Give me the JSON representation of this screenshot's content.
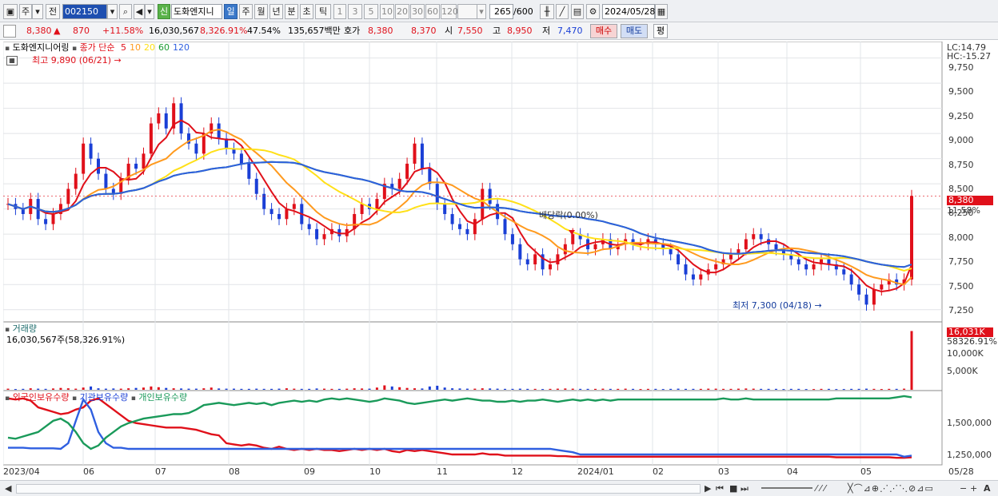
{
  "toolbar": {
    "type_label": "주",
    "prev_label": "전",
    "code_value": "002150",
    "stock_name": "도화엔지니",
    "badge_label": "신",
    "periods": [
      "일",
      "주",
      "월",
      "년",
      "분",
      "초",
      "틱"
    ],
    "minutes": [
      "1",
      "3",
      "5",
      "10",
      "20",
      "30",
      "60",
      "120"
    ],
    "count_value": "265",
    "count_max": "/600",
    "date_value": "2024/05/28"
  },
  "quote": {
    "price": "8,380",
    "change": "870",
    "change_pct": "+11.58%",
    "volume": "16,030,567",
    "volume_pct": "8,326.91%",
    "turnover_pct": "47.54%",
    "amount": "135,657백만",
    "hoga_label": "호가",
    "hoga_ask": "8,380",
    "hoga_bid": "8,370",
    "open_label": "시",
    "open": "7,550",
    "high_label": "고",
    "high": "8,950",
    "low_label": "저",
    "low": "7,470",
    "buy_label": "매수",
    "sell_label": "매도",
    "eval_label": "평"
  },
  "price_panel": {
    "name": "도화엔지니어링",
    "ma_title": "종가 단순",
    "ma_periods": [
      "5",
      "10",
      "20",
      "60",
      "120"
    ],
    "ma_colors": [
      "#e0101a",
      "#ff9a1e",
      "#ffe018",
      "#1a9a30",
      "#2f5fe0"
    ],
    "max_label": "최고 9,890 (06/21)",
    "min_label": "최저 7,300 (04/18)",
    "dividend_label": "배당락(0.00%)",
    "lc_label": "LC:14.79",
    "hc_label": "HC:-15.27",
    "last_price_label": "8,380",
    "last_pct_label": "11.58%",
    "y_ticks": [
      "9,750",
      "9,500",
      "9,250",
      "9,000",
      "8,750",
      "8,500",
      "8,250",
      "8,000",
      "7,750",
      "7,500",
      "7,250"
    ]
  },
  "volume_panel": {
    "title": "거래량",
    "value_label": "16,030,567주(58,326.91%)",
    "last_label": "16,031K",
    "last_pct": "58326.91%",
    "y_ticks": [
      "10,000K",
      "5,000K"
    ]
  },
  "holding_panel": {
    "legend": [
      "외국인보유수량",
      "기관보유수량",
      "개인보유수량"
    ],
    "colors": [
      "#e0101a",
      "#2f5fe0",
      "#1a9a5a"
    ],
    "y_ticks": [
      "1,500,000",
      "1,250,000"
    ]
  },
  "x_axis": [
    "2023/04",
    "06",
    "07",
    "08",
    "09",
    "10",
    "11",
    "12",
    "2024/01",
    "02",
    "03",
    "04",
    "05",
    "05/28"
  ],
  "chart_data": {
    "type": "line",
    "title": "도화엔지니어링",
    "ylim": [
      7200,
      9850
    ],
    "close": [
      8300,
      8250,
      8200,
      8350,
      8150,
      8100,
      8200,
      8300,
      8450,
      8600,
      8900,
      8750,
      8600,
      8450,
      8400,
      8550,
      8700,
      8650,
      8800,
      9100,
      9200,
      9050,
      9300,
      9000,
      8900,
      8800,
      9000,
      9100,
      8950,
      8850,
      8800,
      8700,
      8550,
      8400,
      8250,
      8200,
      8150,
      8250,
      8300,
      8100,
      8050,
      7950,
      8000,
      8050,
      7980,
      8050,
      8200,
      8300,
      8250,
      8350,
      8500,
      8450,
      8550,
      8700,
      8900,
      8650,
      8500,
      8300,
      8200,
      8100,
      8050,
      8000,
      8150,
      8450,
      8300,
      8150,
      8000,
      7900,
      7750,
      7700,
      7800,
      7650,
      7700,
      7800,
      7900,
      8000,
      7950,
      7850,
      7900,
      7950,
      7850,
      7900,
      7950,
      7900,
      7900,
      7950,
      7900,
      7850,
      7800,
      7700,
      7600,
      7550,
      7600,
      7650,
      7700,
      7750,
      7800,
      7850,
      7950,
      8000,
      7950,
      7900,
      7850,
      7800,
      7750,
      7700,
      7650,
      7700,
      7750,
      7700,
      7650,
      7600,
      7500,
      7400,
      7300,
      7450,
      7500,
      7550,
      7500,
      7550,
      8380
    ],
    "volume_k": [
      300,
      200,
      250,
      400,
      300,
      250,
      350,
      500,
      400,
      300,
      600,
      900,
      400,
      300,
      350,
      300,
      400,
      500,
      600,
      900,
      700,
      500,
      400,
      350,
      300,
      300,
      400,
      600,
      350,
      300,
      300,
      250,
      250,
      300,
      250,
      250,
      300,
      400,
      300,
      250,
      250,
      350,
      300,
      250,
      250,
      300,
      400,
      350,
      300,
      600,
      1200,
      900,
      700,
      500,
      400,
      350,
      900,
      1100,
      600,
      400,
      350,
      300,
      300,
      400,
      350,
      300,
      250,
      250,
      300,
      250,
      250,
      200,
      250,
      300,
      350,
      300,
      250,
      250,
      250,
      300,
      250,
      250,
      300,
      250,
      200,
      250,
      250,
      200,
      250,
      300,
      250,
      250,
      250,
      300,
      300,
      250,
      250,
      300,
      350,
      300,
      250,
      250,
      250,
      200,
      250,
      250,
      200,
      200,
      250,
      250,
      200,
      200,
      250,
      250,
      300,
      250,
      200,
      250,
      250,
      300,
      16031
    ],
    "foreign": [
      1700,
      1690,
      1700,
      1680,
      1620,
      1600,
      1580,
      1560,
      1570,
      1600,
      1620,
      1680,
      1700,
      1650,
      1600,
      1550,
      1500,
      1480,
      1470,
      1460,
      1450,
      1440,
      1440,
      1440,
      1430,
      1420,
      1400,
      1380,
      1370,
      1300,
      1290,
      1280,
      1290,
      1280,
      1260,
      1250,
      1270,
      1250,
      1240,
      1250,
      1240,
      1250,
      1240,
      1240,
      1230,
      1240,
      1250,
      1240,
      1250,
      1240,
      1250,
      1230,
      1220,
      1240,
      1230,
      1240,
      1230,
      1220,
      1210,
      1200,
      1200,
      1200,
      1200,
      1210,
      1200,
      1200,
      1190,
      1190,
      1190,
      1190,
      1190,
      1190,
      1190,
      1185,
      1185,
      1180,
      1180,
      1180,
      1180,
      1180,
      1180,
      1180,
      1180,
      1180,
      1180,
      1180,
      1180,
      1180,
      1180,
      1180,
      1180,
      1180,
      1180,
      1180,
      1180,
      1180,
      1180,
      1180,
      1180,
      1180,
      1180,
      1180,
      1180,
      1180,
      1180,
      1180,
      1180,
      1180,
      1180,
      1180,
      1175,
      1175,
      1175,
      1175,
      1175,
      1175,
      1175,
      1175,
      1170,
      1170,
      1175
    ],
    "institution": [
      1260,
      1260,
      1260,
      1255,
      1255,
      1255,
      1255,
      1250,
      1300,
      1500,
      1690,
      1600,
      1400,
      1300,
      1260,
      1260,
      1250,
      1250,
      1250,
      1250,
      1250,
      1250,
      1250,
      1250,
      1250,
      1250,
      1250,
      1250,
      1250,
      1250,
      1250,
      1250,
      1250,
      1250,
      1250,
      1250,
      1250,
      1250,
      1250,
      1250,
      1250,
      1250,
      1250,
      1250,
      1250,
      1250,
      1250,
      1250,
      1250,
      1250,
      1250,
      1250,
      1250,
      1250,
      1250,
      1250,
      1250,
      1250,
      1250,
      1250,
      1250,
      1250,
      1250,
      1250,
      1250,
      1250,
      1250,
      1250,
      1250,
      1250,
      1250,
      1250,
      1250,
      1240,
      1230,
      1220,
      1200,
      1200,
      1200,
      1200,
      1200,
      1200,
      1200,
      1200,
      1200,
      1200,
      1200,
      1200,
      1200,
      1200,
      1200,
      1200,
      1200,
      1200,
      1200,
      1200,
      1200,
      1200,
      1200,
      1200,
      1200,
      1200,
      1200,
      1200,
      1200,
      1200,
      1200,
      1200,
      1200,
      1200,
      1200,
      1200,
      1200,
      1200,
      1200,
      1200,
      1200,
      1200,
      1200,
      1180,
      1190
    ],
    "individual": [
      1350,
      1340,
      1360,
      1380,
      1400,
      1450,
      1500,
      1520,
      1480,
      1400,
      1300,
      1250,
      1280,
      1350,
      1400,
      1450,
      1480,
      1500,
      1520,
      1530,
      1540,
      1550,
      1560,
      1560,
      1570,
      1600,
      1640,
      1650,
      1660,
      1650,
      1640,
      1650,
      1660,
      1650,
      1660,
      1640,
      1660,
      1670,
      1680,
      1670,
      1680,
      1670,
      1690,
      1700,
      1690,
      1700,
      1690,
      1680,
      1670,
      1680,
      1700,
      1690,
      1680,
      1660,
      1650,
      1660,
      1670,
      1680,
      1690,
      1680,
      1690,
      1700,
      1690,
      1680,
      1680,
      1670,
      1670,
      1680,
      1670,
      1680,
      1680,
      1690,
      1680,
      1670,
      1680,
      1690,
      1680,
      1690,
      1680,
      1690,
      1680,
      1690,
      1690,
      1690,
      1690,
      1690,
      1690,
      1690,
      1690,
      1690,
      1690,
      1690,
      1690,
      1690,
      1690,
      1700,
      1690,
      1690,
      1700,
      1690,
      1690,
      1690,
      1690,
      1690,
      1690,
      1690,
      1690,
      1690,
      1690,
      1690,
      1700,
      1700,
      1700,
      1700,
      1700,
      1700,
      1700,
      1700,
      1710,
      1720,
      1710
    ]
  }
}
